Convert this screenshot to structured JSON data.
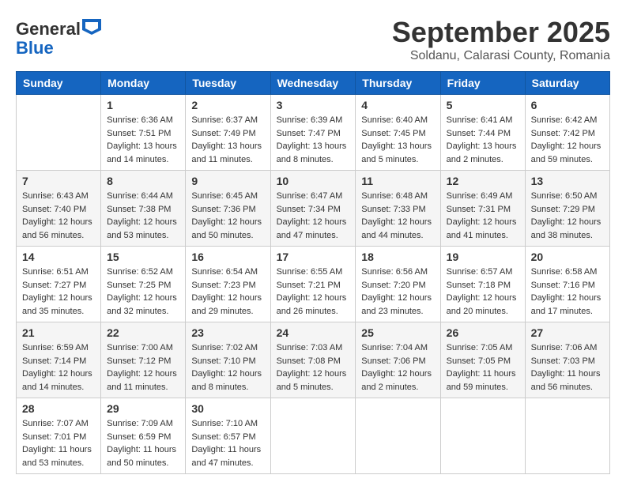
{
  "header": {
    "logo_general": "General",
    "logo_blue": "Blue",
    "month_year": "September 2025",
    "location": "Soldanu, Calarasi County, Romania"
  },
  "days_of_week": [
    "Sunday",
    "Monday",
    "Tuesday",
    "Wednesday",
    "Thursday",
    "Friday",
    "Saturday"
  ],
  "weeks": [
    [
      {
        "day": "",
        "sunrise": "",
        "sunset": "",
        "daylight": ""
      },
      {
        "day": "1",
        "sunrise": "Sunrise: 6:36 AM",
        "sunset": "Sunset: 7:51 PM",
        "daylight": "Daylight: 13 hours and 14 minutes."
      },
      {
        "day": "2",
        "sunrise": "Sunrise: 6:37 AM",
        "sunset": "Sunset: 7:49 PM",
        "daylight": "Daylight: 13 hours and 11 minutes."
      },
      {
        "day": "3",
        "sunrise": "Sunrise: 6:39 AM",
        "sunset": "Sunset: 7:47 PM",
        "daylight": "Daylight: 13 hours and 8 minutes."
      },
      {
        "day": "4",
        "sunrise": "Sunrise: 6:40 AM",
        "sunset": "Sunset: 7:45 PM",
        "daylight": "Daylight: 13 hours and 5 minutes."
      },
      {
        "day": "5",
        "sunrise": "Sunrise: 6:41 AM",
        "sunset": "Sunset: 7:44 PM",
        "daylight": "Daylight: 13 hours and 2 minutes."
      },
      {
        "day": "6",
        "sunrise": "Sunrise: 6:42 AM",
        "sunset": "Sunset: 7:42 PM",
        "daylight": "Daylight: 12 hours and 59 minutes."
      }
    ],
    [
      {
        "day": "7",
        "sunrise": "Sunrise: 6:43 AM",
        "sunset": "Sunset: 7:40 PM",
        "daylight": "Daylight: 12 hours and 56 minutes."
      },
      {
        "day": "8",
        "sunrise": "Sunrise: 6:44 AM",
        "sunset": "Sunset: 7:38 PM",
        "daylight": "Daylight: 12 hours and 53 minutes."
      },
      {
        "day": "9",
        "sunrise": "Sunrise: 6:45 AM",
        "sunset": "Sunset: 7:36 PM",
        "daylight": "Daylight: 12 hours and 50 minutes."
      },
      {
        "day": "10",
        "sunrise": "Sunrise: 6:47 AM",
        "sunset": "Sunset: 7:34 PM",
        "daylight": "Daylight: 12 hours and 47 minutes."
      },
      {
        "day": "11",
        "sunrise": "Sunrise: 6:48 AM",
        "sunset": "Sunset: 7:33 PM",
        "daylight": "Daylight: 12 hours and 44 minutes."
      },
      {
        "day": "12",
        "sunrise": "Sunrise: 6:49 AM",
        "sunset": "Sunset: 7:31 PM",
        "daylight": "Daylight: 12 hours and 41 minutes."
      },
      {
        "day": "13",
        "sunrise": "Sunrise: 6:50 AM",
        "sunset": "Sunset: 7:29 PM",
        "daylight": "Daylight: 12 hours and 38 minutes."
      }
    ],
    [
      {
        "day": "14",
        "sunrise": "Sunrise: 6:51 AM",
        "sunset": "Sunset: 7:27 PM",
        "daylight": "Daylight: 12 hours and 35 minutes."
      },
      {
        "day": "15",
        "sunrise": "Sunrise: 6:52 AM",
        "sunset": "Sunset: 7:25 PM",
        "daylight": "Daylight: 12 hours and 32 minutes."
      },
      {
        "day": "16",
        "sunrise": "Sunrise: 6:54 AM",
        "sunset": "Sunset: 7:23 PM",
        "daylight": "Daylight: 12 hours and 29 minutes."
      },
      {
        "day": "17",
        "sunrise": "Sunrise: 6:55 AM",
        "sunset": "Sunset: 7:21 PM",
        "daylight": "Daylight: 12 hours and 26 minutes."
      },
      {
        "day": "18",
        "sunrise": "Sunrise: 6:56 AM",
        "sunset": "Sunset: 7:20 PM",
        "daylight": "Daylight: 12 hours and 23 minutes."
      },
      {
        "day": "19",
        "sunrise": "Sunrise: 6:57 AM",
        "sunset": "Sunset: 7:18 PM",
        "daylight": "Daylight: 12 hours and 20 minutes."
      },
      {
        "day": "20",
        "sunrise": "Sunrise: 6:58 AM",
        "sunset": "Sunset: 7:16 PM",
        "daylight": "Daylight: 12 hours and 17 minutes."
      }
    ],
    [
      {
        "day": "21",
        "sunrise": "Sunrise: 6:59 AM",
        "sunset": "Sunset: 7:14 PM",
        "daylight": "Daylight: 12 hours and 14 minutes."
      },
      {
        "day": "22",
        "sunrise": "Sunrise: 7:00 AM",
        "sunset": "Sunset: 7:12 PM",
        "daylight": "Daylight: 12 hours and 11 minutes."
      },
      {
        "day": "23",
        "sunrise": "Sunrise: 7:02 AM",
        "sunset": "Sunset: 7:10 PM",
        "daylight": "Daylight: 12 hours and 8 minutes."
      },
      {
        "day": "24",
        "sunrise": "Sunrise: 7:03 AM",
        "sunset": "Sunset: 7:08 PM",
        "daylight": "Daylight: 12 hours and 5 minutes."
      },
      {
        "day": "25",
        "sunrise": "Sunrise: 7:04 AM",
        "sunset": "Sunset: 7:06 PM",
        "daylight": "Daylight: 12 hours and 2 minutes."
      },
      {
        "day": "26",
        "sunrise": "Sunrise: 7:05 AM",
        "sunset": "Sunset: 7:05 PM",
        "daylight": "Daylight: 11 hours and 59 minutes."
      },
      {
        "day": "27",
        "sunrise": "Sunrise: 7:06 AM",
        "sunset": "Sunset: 7:03 PM",
        "daylight": "Daylight: 11 hours and 56 minutes."
      }
    ],
    [
      {
        "day": "28",
        "sunrise": "Sunrise: 7:07 AM",
        "sunset": "Sunset: 7:01 PM",
        "daylight": "Daylight: 11 hours and 53 minutes."
      },
      {
        "day": "29",
        "sunrise": "Sunrise: 7:09 AM",
        "sunset": "Sunset: 6:59 PM",
        "daylight": "Daylight: 11 hours and 50 minutes."
      },
      {
        "day": "30",
        "sunrise": "Sunrise: 7:10 AM",
        "sunset": "Sunset: 6:57 PM",
        "daylight": "Daylight: 11 hours and 47 minutes."
      },
      {
        "day": "",
        "sunrise": "",
        "sunset": "",
        "daylight": ""
      },
      {
        "day": "",
        "sunrise": "",
        "sunset": "",
        "daylight": ""
      },
      {
        "day": "",
        "sunrise": "",
        "sunset": "",
        "daylight": ""
      },
      {
        "day": "",
        "sunrise": "",
        "sunset": "",
        "daylight": ""
      }
    ]
  ]
}
